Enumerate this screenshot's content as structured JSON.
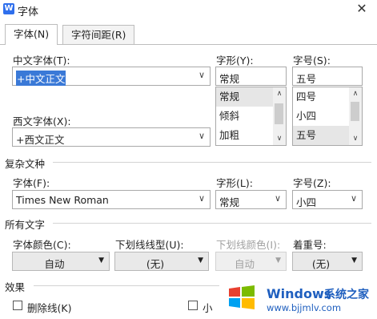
{
  "window": {
    "title": "字体",
    "app_icon": "W",
    "close": "✕"
  },
  "tabs": [
    {
      "label": "字体(N)"
    },
    {
      "label": "字符间距(R)"
    }
  ],
  "chinese_font": {
    "label": "中文字体(T):",
    "value": "+中文正文"
  },
  "style": {
    "label": "字形(Y):",
    "value": "常规",
    "options": [
      "常规",
      "倾斜",
      "加粗"
    ]
  },
  "size": {
    "label": "字号(S):",
    "value": "五号",
    "options": [
      "四号",
      "小四",
      "五号"
    ]
  },
  "western_font": {
    "label": "西文字体(X):",
    "value": "+西文正文"
  },
  "complex": {
    "section": "复杂文种",
    "font_label": "字体(F):",
    "font_value": "Times New Roman",
    "style_label": "字形(L):",
    "style_value": "常规",
    "size_label": "字号(Z):",
    "size_value": "小四"
  },
  "all_text": {
    "section": "所有文字",
    "color_label": "字体颜色(C):",
    "color_value": "自动",
    "underline_label": "下划线线型(U):",
    "underline_value": "(无)",
    "underline_color_label": "下划线颜色(I):",
    "underline_color_value": "自动",
    "emphasis_label": "着重号:",
    "emphasis_value": "(无)"
  },
  "effects": {
    "section": "效果",
    "strikethrough": "删除线(K)",
    "small_caps_partial": "小"
  },
  "watermark": {
    "brand": "Windows",
    "brand_cn": "系统之家",
    "url": "www.bjjmlv.com"
  },
  "colors": {
    "accent": "#3a79d7",
    "watermark": "#1f5fbf"
  }
}
